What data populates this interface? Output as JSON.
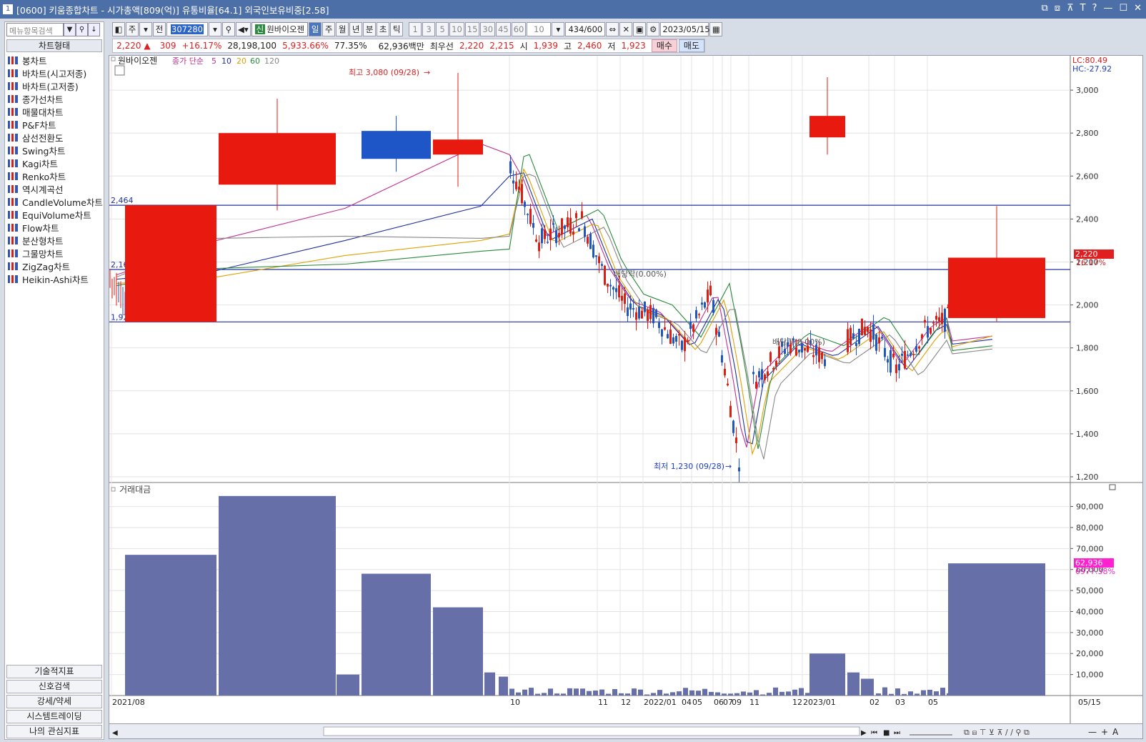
{
  "window": {
    "num": "1",
    "title": "[0600] 키움종합차트 - 시가총액[809(억)] 유통비율[64.1] 외국인보유비중[2.58]",
    "controls": [
      "⧉",
      "⧈",
      "⊼",
      "T",
      "?",
      "—",
      "☐",
      "✕"
    ]
  },
  "sidebar": {
    "search_placeholder": "메뉴항목검색",
    "header": "차트형태",
    "items": [
      "봉차트",
      "바차트(시고저종)",
      "바차트(고저종)",
      "종가선차트",
      "매물대차트",
      "P&F차트",
      "삼선전환도",
      "Swing차트",
      "Kagi차트",
      "Renko차트",
      "역시계곡선",
      "CandleVolume차트",
      "EquiVolume차트",
      "Flow차트",
      "분산형차트",
      "그물망차트",
      "ZigZag차트",
      "Heikin-Ashi차트"
    ],
    "bottom": [
      "기술적지표",
      "신호검색",
      "강세/약세",
      "시스템트레이딩",
      "나의 관심지표"
    ]
  },
  "toolbar": {
    "period_label": "주",
    "prev_label": "전",
    "code": "307280",
    "stock_name": "원바이오젠",
    "xin": "신",
    "periods": [
      "일",
      "주",
      "월",
      "년",
      "분",
      "초",
      "틱"
    ],
    "intervals": [
      "1",
      "3",
      "5",
      "10",
      "15",
      "30",
      "45",
      "60"
    ],
    "interval_value": "10",
    "count": "434",
    "count_max": "/600",
    "date": "2023/05/15"
  },
  "quote": {
    "price": "2,220 ▲",
    "change": "309",
    "change_pct": "+16.17%",
    "volume": "28,198,100",
    "volume_pct": "5,933.66%",
    "turnover": "77.35%",
    "amount": "62,936백만",
    "best_label": "최우선",
    "best_ask": "2,220",
    "best_bid": "2,215",
    "open_label": "시",
    "open": "1,939",
    "high_label": "고",
    "high": "2,460",
    "low_label": "저",
    "low": "1,923",
    "buy": "매수",
    "sell": "매도"
  },
  "chart_data": {
    "type": "candlestick",
    "legend": {
      "name": "원바이오젠",
      "ma_label": "종가 단순",
      "ma_periods": [
        "5",
        "10",
        "20",
        "60",
        "120"
      ],
      "ma_colors": [
        "#c03090",
        "#2030a0",
        "#e0a000",
        "#2a8a3a",
        "#888888"
      ]
    },
    "lc": "LC:80.49",
    "hc": "HC:-27.92",
    "y_ticks": [
      "3,000",
      "2,800",
      "2,600",
      "2,400",
      "2,200",
      "2,000",
      "1,800",
      "1,600",
      "1,400",
      "1,200"
    ],
    "y_values": [
      3000,
      2800,
      2600,
      2400,
      2200,
      2000,
      1800,
      1600,
      1400,
      1200
    ],
    "ylim": [
      1180,
      3150
    ],
    "hlines": [
      {
        "label": "2,464",
        "value": 2464
      },
      {
        "label": "2,165",
        "value": 2165
      },
      {
        "label": "1,921",
        "value": 1921
      }
    ],
    "max_note": "최고 3,080 (09/28)",
    "min_note": "최저 1,230 (09/28)",
    "dividend_notes": [
      "배당락(0.00%)",
      "배당락(0.00%)"
    ],
    "current_price_label": "2,220",
    "current_pct_label": "16.17%",
    "candles": [
      {
        "open": 1921,
        "high": 2380,
        "low": 2160,
        "close": 2464,
        "up": true
      },
      {
        "open": 2560,
        "high": 2960,
        "low": 2440,
        "close": 2800,
        "up": true
      },
      {
        "open": 2810,
        "high": 2880,
        "low": 2620,
        "close": 2680,
        "up": false
      },
      {
        "open": 2700,
        "high": 3080,
        "low": 2550,
        "close": 2770,
        "up": true
      },
      {
        "open": 2780,
        "high": 3060,
        "low": 2700,
        "close": 2880,
        "up": true
      },
      {
        "open": 1939,
        "high": 2460,
        "low": 1923,
        "close": 2220,
        "up": true
      }
    ],
    "volume_panel": {
      "title": "거래대금",
      "y_ticks": [
        "90,000",
        "80,000",
        "70,000",
        "60,000",
        "50,000",
        "40,000",
        "30,000",
        "20,000",
        "10,000"
      ],
      "y_values": [
        90000,
        80000,
        70000,
        60000,
        50000,
        40000,
        30000,
        20000,
        10000
      ],
      "ylim": [
        0,
        97000
      ],
      "current_label": "62,936",
      "current_pct": "6977.38%",
      "bars": [
        67000,
        95000,
        10000,
        58000,
        42000,
        11000,
        9000,
        20000,
        11000,
        8000,
        62936
      ]
    },
    "x_labels": [
      "2021/08",
      "10",
      "11",
      "12",
      "2022/01",
      "04",
      "05",
      "06",
      "07",
      "09",
      "11",
      "12",
      "2023/01",
      "02",
      "03",
      "05"
    ],
    "x_end_label": "05/15"
  }
}
